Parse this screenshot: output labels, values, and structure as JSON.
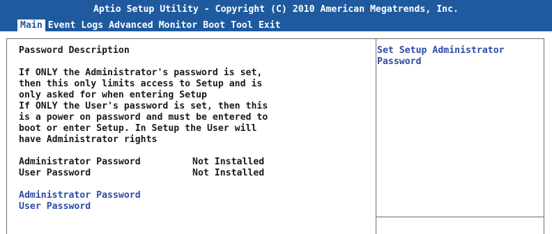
{
  "header": {
    "title": "Aptio Setup Utility - Copyright (C) 2010 American Megatrends, Inc."
  },
  "menu": {
    "items": [
      {
        "label": "Main",
        "active": true
      },
      {
        "label": "Event Logs",
        "active": false
      },
      {
        "label": "Advanced",
        "active": false
      },
      {
        "label": "Monitor",
        "active": false
      },
      {
        "label": "Boot",
        "active": false
      },
      {
        "label": "Tool",
        "active": false
      },
      {
        "label": "Exit",
        "active": false
      }
    ]
  },
  "main": {
    "heading": "Password Description",
    "description": [
      "If ONLY the Administrator's password is set,",
      "then this only limits access to Setup and is",
      "only asked for when entering Setup",
      "If ONLY the User's password is set, then this",
      "is a power on password and must be entered to",
      "boot or enter Setup. In Setup the User will",
      "have Administrator rights"
    ],
    "status": [
      {
        "label": "Administrator Password",
        "value": "Not Installed"
      },
      {
        "label": "User Password",
        "value": "Not Installed"
      }
    ],
    "options": [
      {
        "label": "Administrator Password"
      },
      {
        "label": "User Password"
      }
    ]
  },
  "help": {
    "lines": [
      "Set Setup Administrator",
      "Password"
    ]
  },
  "colors": {
    "header_bg": "#1f5a9e",
    "text": "#1a1a1a",
    "link": "#2c4aa5",
    "border": "#6f6f6f"
  }
}
